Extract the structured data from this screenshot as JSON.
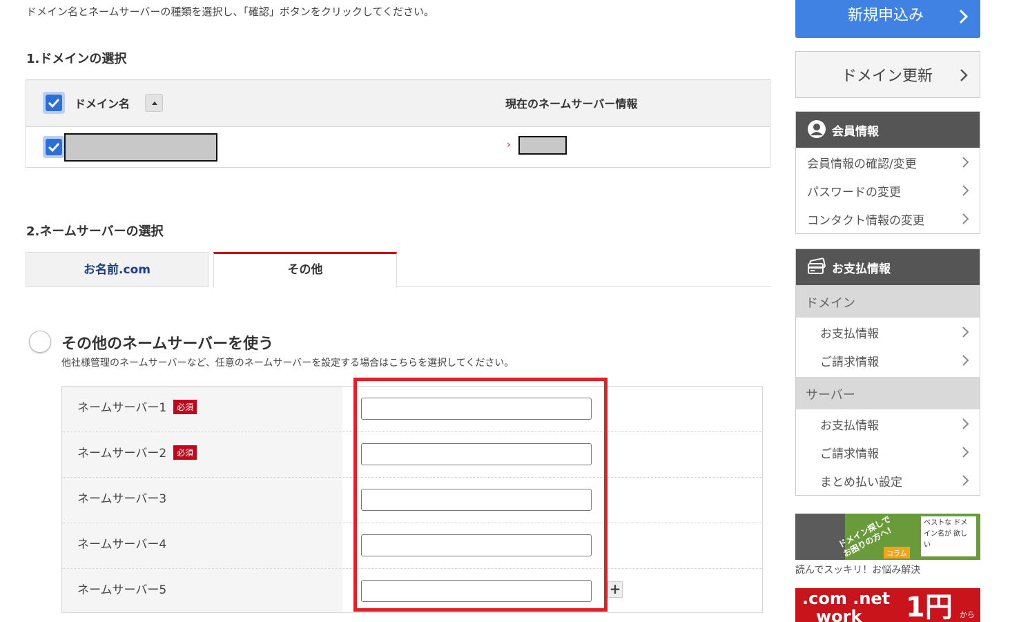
{
  "intro": "ドメイン名とネームサーバーの種類を選択し、「確認」ボタンをクリックしてください。",
  "section1": {
    "title": "1.ドメインの選択",
    "col_domain": "ドメイン名",
    "col_ns": "現在のネームサーバー情報",
    "row_marker": "›"
  },
  "section2": {
    "title": "2.ネームサーバーの選択",
    "tabs": [
      "お名前.com",
      "その他"
    ],
    "option_title": "その他のネームサーバーを使う",
    "option_desc": "他社様管理のネームサーバーなど、任意のネームサーバーを設定する場合はこちらを選択してください。",
    "required_badge": "必須",
    "rows": [
      {
        "label": "ネームサーバー1",
        "value": ""
      },
      {
        "label": "ネームサーバー2",
        "value": ""
      },
      {
        "label": "ネームサーバー3",
        "value": ""
      },
      {
        "label": "ネームサーバー4",
        "value": ""
      },
      {
        "label": "ネームサーバー5",
        "value": ""
      }
    ],
    "add_button": "+"
  },
  "sidebar": {
    "new_button": "新規申込み",
    "renew_button": "ドメイン更新",
    "member": {
      "title": "会員情報",
      "items": [
        "会員情報の確認/変更",
        "パスワードの変更",
        "コンタクト情報の変更"
      ]
    },
    "payment": {
      "title": "お支払情報",
      "groups": [
        {
          "name": "ドメイン",
          "items": [
            "お支払情報",
            "ご請求情報"
          ]
        },
        {
          "name": "サーバー",
          "items": [
            "お支払情報",
            "ご請求情報",
            "まとめ払い設定"
          ]
        }
      ]
    },
    "banner1": {
      "line1": "ドメイン探しで",
      "line2": "お困りの方へ!",
      "tag": "コラム",
      "note": "ベストな ドメイン名が 欲しい",
      "caption": "読んでスッキリ！お悩み解決"
    },
    "banner2": {
      "text1": ".com .net",
      "text2": "work",
      "price": "1円",
      "from": "から"
    }
  },
  "colors": {
    "accent_blue": "#3f82e4",
    "required_red": "#c0071b",
    "highlight_red": "#e0202a"
  }
}
